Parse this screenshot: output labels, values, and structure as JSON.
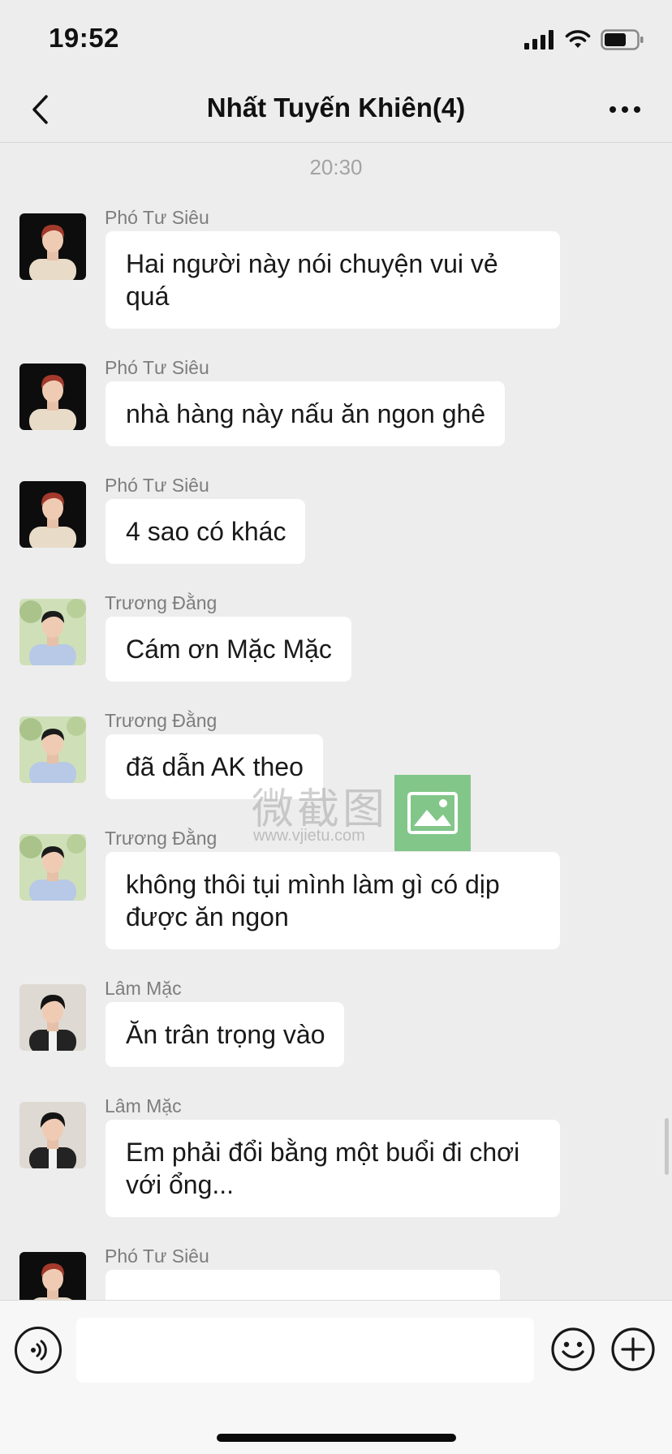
{
  "status_bar": {
    "time": "19:52"
  },
  "nav": {
    "title": "Nhất Tuyến Khiên(4)"
  },
  "chat": {
    "timestamp": "20:30",
    "messages": [
      {
        "sender": "Phó Tư Siêu",
        "text": "Hai người này nói chuyện vui vẻ quá",
        "avatar": "avatar-pho-tu-sieu"
      },
      {
        "sender": "Phó Tư Siêu",
        "text": "nhà hàng này nấu ăn ngon ghê",
        "avatar": "avatar-pho-tu-sieu"
      },
      {
        "sender": "Phó Tư Siêu",
        "text": "4 sao có khác",
        "avatar": "avatar-pho-tu-sieu"
      },
      {
        "sender": "Trương Đằng",
        "text": "Cám ơn Mặc Mặc",
        "avatar": "avatar-truong-dang"
      },
      {
        "sender": "Trương Đằng",
        "text": "đã dẫn AK theo",
        "avatar": "avatar-truong-dang"
      },
      {
        "sender": "Trương Đằng",
        "text": "không thôi tụi mình làm gì có dịp được ăn ngon",
        "avatar": "avatar-truong-dang"
      },
      {
        "sender": "Lâm Mặc",
        "text": "Ăn trân trọng vào",
        "avatar": "avatar-lam-mac"
      },
      {
        "sender": "Lâm Mặc",
        "text": "Em phải đổi bằng một buổi đi chơi với ổng...",
        "avatar": "avatar-lam-mac"
      },
      {
        "sender": "Phó Tư Siêu",
        "text": "",
        "avatar": "avatar-pho-tu-sieu"
      }
    ]
  },
  "watermark": {
    "text": "微截图",
    "url": "www.vjietu.com"
  },
  "input": {
    "value": "",
    "placeholder": ""
  },
  "icons": {
    "back": "chevron-left-icon",
    "more": "more-dots-icon",
    "voice": "voice-icon",
    "emoji": "emoji-icon",
    "plus": "plus-icon",
    "watermark": "image-icon"
  },
  "colors": {
    "background": "#ededed",
    "bubble": "#ffffff",
    "sender_text": "#7d7d7d",
    "watermark_green": "#6ebe78"
  }
}
